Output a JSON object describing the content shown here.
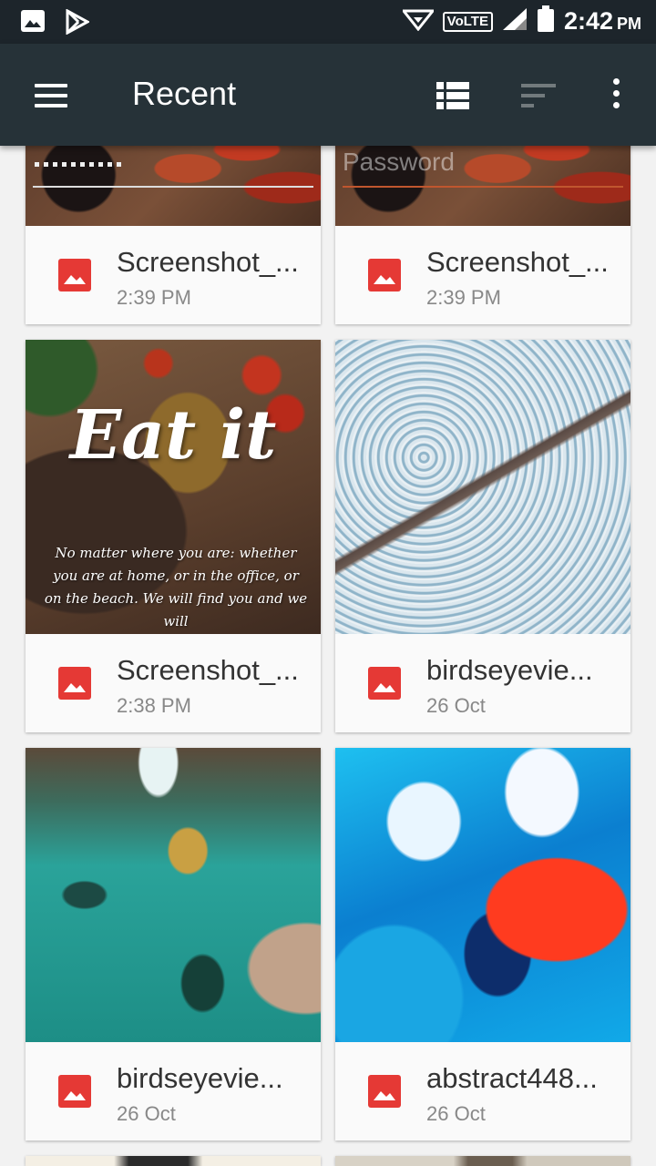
{
  "status_bar": {
    "time": "2:42",
    "ampm": "PM",
    "network_label": "VoLTE",
    "icons": [
      "gallery-icon",
      "play-store-icon",
      "wifi-icon",
      "signal-icon",
      "battery-icon"
    ]
  },
  "app_bar": {
    "title": "Recent",
    "icons": [
      "menu-icon",
      "list-view-icon",
      "sort-icon",
      "more-vert-icon"
    ]
  },
  "files": [
    {
      "name": "Screenshot_...",
      "date": "2:39 PM"
    },
    {
      "name": "Screenshot_...",
      "date": "2:39 PM"
    },
    {
      "name": "Screenshot_...",
      "date": "2:38 PM"
    },
    {
      "name": "birdseyevie...",
      "date": "26 Oct"
    },
    {
      "name": "birdseyevie...",
      "date": "26 Oct"
    },
    {
      "name": "abstract448...",
      "date": "26 Oct"
    }
  ],
  "thumbnails": {
    "card2_overlay": "Password",
    "eat_it_title": "Eat it",
    "eat_it_quote": "No matter where you are: whether you are at home, or in the office, or on the beach. We will find you and we will"
  },
  "colors": {
    "status_bar": "#1d252b",
    "app_bar": "#263238",
    "image_icon": "#e53935",
    "background": "#f2f2f2"
  }
}
